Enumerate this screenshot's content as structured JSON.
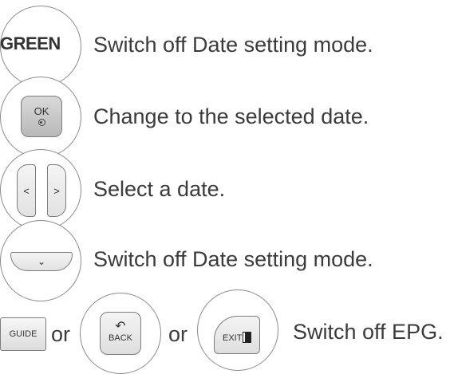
{
  "rows": [
    {
      "button": "GREEN",
      "text": "Switch off Date setting mode."
    },
    {
      "button": "OK",
      "text": "Change to the selected date."
    },
    {
      "button_left": "<",
      "button_right": ">",
      "text": "Select a date."
    },
    {
      "button": "⌄",
      "text": "Switch off Date setting mode."
    }
  ],
  "last_row": {
    "guide_label": "GUIDE",
    "or_1": "or",
    "back_label": "BACK",
    "or_2": "or",
    "exit_label": "EXIT",
    "text": "Switch off EPG."
  }
}
